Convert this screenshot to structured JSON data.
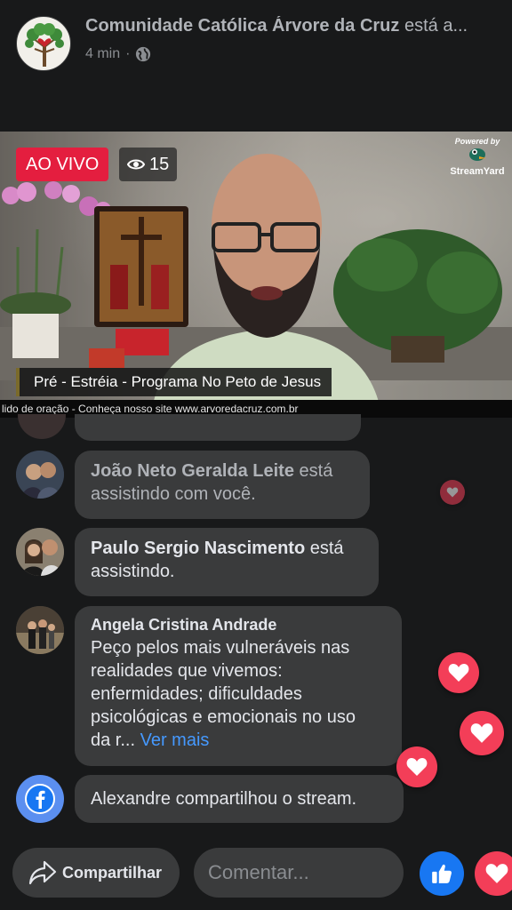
{
  "header": {
    "page_name": "Comunidade Católica Árvore da Cruz",
    "status": " está a...",
    "time": "4 min",
    "separator": "·"
  },
  "video": {
    "live_label": "AO VIVO",
    "viewers": "15",
    "powered_by": "Powered by",
    "streamyard": "StreamYard",
    "title": "Pré - Estréia - Programa No Peto de Jesus",
    "ticker": "lido de oração - Conheça nosso site www.arvoredacruz.com.br"
  },
  "comments": [
    {
      "name": "João Neto Geralda Leite",
      "text": " está",
      "text2": "assistindo com você."
    },
    {
      "name": "Paulo Sergio Nascimento",
      "text": " está",
      "text2": "assistindo."
    },
    {
      "name": "Angela Cristina Andrade",
      "lines": [
        "Peço pelos mais vulneráveis nas",
        "realidades que vivemos:",
        "enfermidades; dificuldades",
        "psicológicas e emocionais no uso",
        "da r..."
      ],
      "see_more": "Ver mais"
    },
    {
      "text": "Alexandre compartilhou o stream."
    }
  ],
  "bottom": {
    "share_label": "Compartilhar",
    "comment_placeholder": "Comentar..."
  },
  "colors": {
    "live": "#e41e3f",
    "facebook": "#1877f2",
    "heart": "#f33e58",
    "link": "#4599ff"
  },
  "icons": [
    "globe-icon",
    "eye-icon",
    "streamyard-icon",
    "heart-icon",
    "share-icon",
    "like-icon",
    "facebook-icon"
  ]
}
